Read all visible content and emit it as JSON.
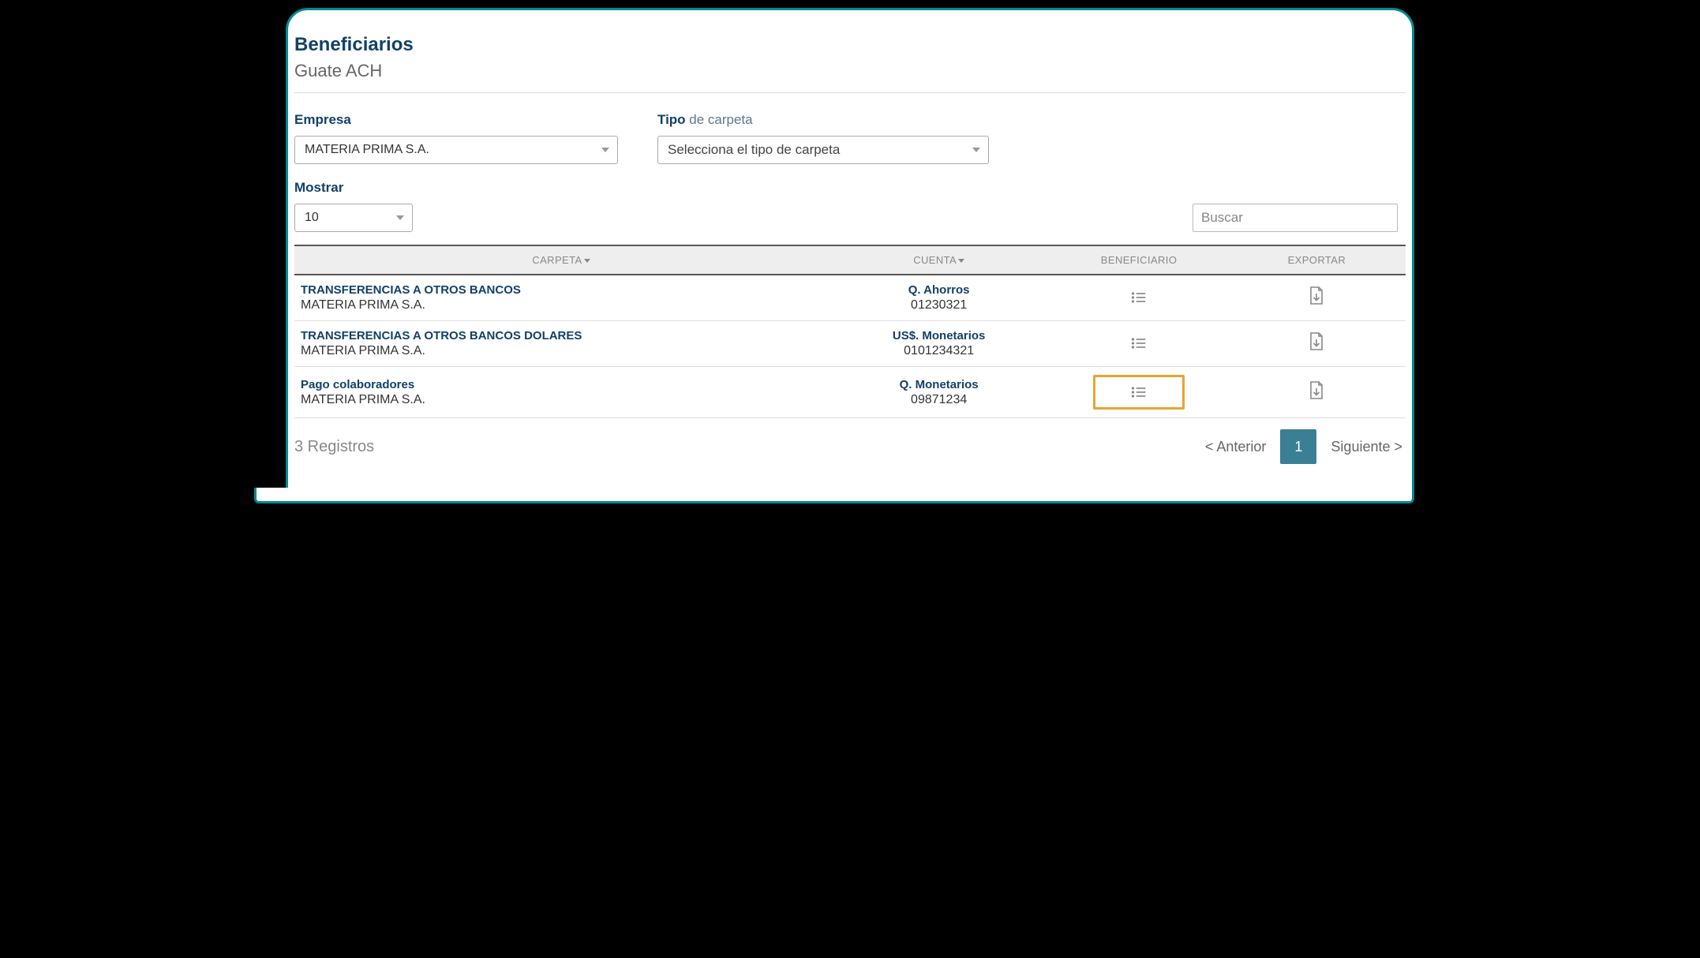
{
  "header": {
    "title": "Beneficiarios",
    "subtitle": "Guate ACH"
  },
  "filters": {
    "empresa": {
      "label": "Empresa",
      "value": "MATERIA PRIMA S.A."
    },
    "tipoCarpeta": {
      "label_dark": "Tipo",
      "label_light": " de carpeta",
      "placeholder": "Selecciona el tipo de carpeta"
    },
    "mostrar": {
      "label": "Mostrar",
      "value": "10"
    },
    "search": {
      "placeholder": "Buscar"
    }
  },
  "table": {
    "headers": {
      "carpeta": "Carpeta",
      "cuenta": "Cuenta",
      "beneficiario": "Beneficiario",
      "exportar": "Exportar"
    },
    "rows": [
      {
        "folder": "TRANSFERENCIAS A OTROS BANCOS",
        "company": "MATERIA PRIMA S.A.",
        "acct_type": "Q. Ahorros",
        "acct_num": "01230321",
        "highlight": false
      },
      {
        "folder": "TRANSFERENCIAS A OTROS BANCOS DOLARES",
        "company": "MATERIA PRIMA S.A.",
        "acct_type": "US$. Monetarios",
        "acct_num": "0101234321",
        "highlight": false
      },
      {
        "folder": "Pago colaboradores",
        "company": "MATERIA PRIMA S.A.",
        "acct_type": "Q. Monetarios",
        "acct_num": "09871234",
        "highlight": true
      }
    ]
  },
  "footer": {
    "records": "3 Registros",
    "prev": "< Anterior",
    "page": "1",
    "next": "Siguiente >"
  }
}
